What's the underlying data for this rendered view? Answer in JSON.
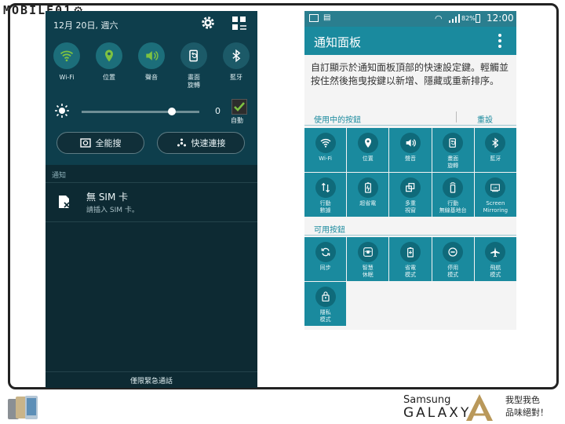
{
  "watermark": {
    "logo_text": "MOBILE01"
  },
  "left_panel": {
    "date": "12月 20日, 週六",
    "quick_settings": [
      {
        "label": "Wi-Fi",
        "icon": "wifi-icon"
      },
      {
        "label": "位置",
        "icon": "location-icon"
      },
      {
        "label": "聲音",
        "icon": "sound-icon"
      },
      {
        "label": "畫面\n旋轉",
        "icon": "rotate-icon"
      },
      {
        "label": "藍牙",
        "icon": "bluetooth-icon"
      }
    ],
    "brightness": {
      "value": "0",
      "auto_label": "自動",
      "auto_checked": true,
      "level": 0.5
    },
    "search_label": "全能搜",
    "quick_connect_label": "快速連接",
    "notifications_header": "通知",
    "notification": {
      "title": "無 SIM 卡",
      "subtitle": "請插入 SIM 卡。"
    },
    "emergency_label": "僅限緊急通話"
  },
  "right_panel": {
    "status_bar": {
      "battery": "82%",
      "time": "12:00"
    },
    "title": "通知面板",
    "description": "自訂顯示於通知面板頂部的快速設定鍵。輕觸並按住然後拖曳按鍵以新增、隱藏或重新排序。",
    "active_section": {
      "label": "使用中的按鈕",
      "reset_label": "重設"
    },
    "active_buttons": [
      {
        "label": "Wi-Fi",
        "icon": "wifi-icon"
      },
      {
        "label": "位置",
        "icon": "location-icon"
      },
      {
        "label": "聲音",
        "icon": "sound-icon"
      },
      {
        "label": "畫面\n旋轉",
        "icon": "rotate-icon"
      },
      {
        "label": "藍牙",
        "icon": "bluetooth-icon"
      },
      {
        "label": "行動\n數據",
        "icon": "mobile-data-icon"
      },
      {
        "label": "超省電",
        "icon": "ultra-power-saving-icon"
      },
      {
        "label": "多重\n視窗",
        "icon": "multi-window-icon"
      },
      {
        "label": "行動\n無線基地台",
        "icon": "hotspot-icon"
      },
      {
        "label": "Screen\nMirroring",
        "icon": "screen-mirroring-icon"
      }
    ],
    "available_section": {
      "label": "可用按鈕"
    },
    "available_buttons": [
      {
        "label": "同步",
        "icon": "sync-icon"
      },
      {
        "label": "智慧\n休眠",
        "icon": "smart-stay-icon"
      },
      {
        "label": "省電\n模式",
        "icon": "power-saving-icon"
      },
      {
        "label": "停用\n模式",
        "icon": "blocking-mode-icon"
      },
      {
        "label": "飛航\n模式",
        "icon": "airplane-icon"
      },
      {
        "label": "隱私\n模式",
        "icon": "private-mode-icon"
      }
    ]
  },
  "footer": {
    "brand_samsung": "Samsung",
    "brand_galaxy": "GALAXY",
    "slogan_line1": "我型我色",
    "slogan_line2": "品味絕對！"
  },
  "colors": {
    "left_bg": "#0d2a33",
    "left_top_bg": "#0e3e4c",
    "qs_circle": "#1c5a68",
    "right_appbar": "#1a8a9e",
    "right_status": "#2a7e8f",
    "tile_bg": "#1a8a9e",
    "tile_circle": "#0f6a7a",
    "accent_green": "#7dc242"
  }
}
